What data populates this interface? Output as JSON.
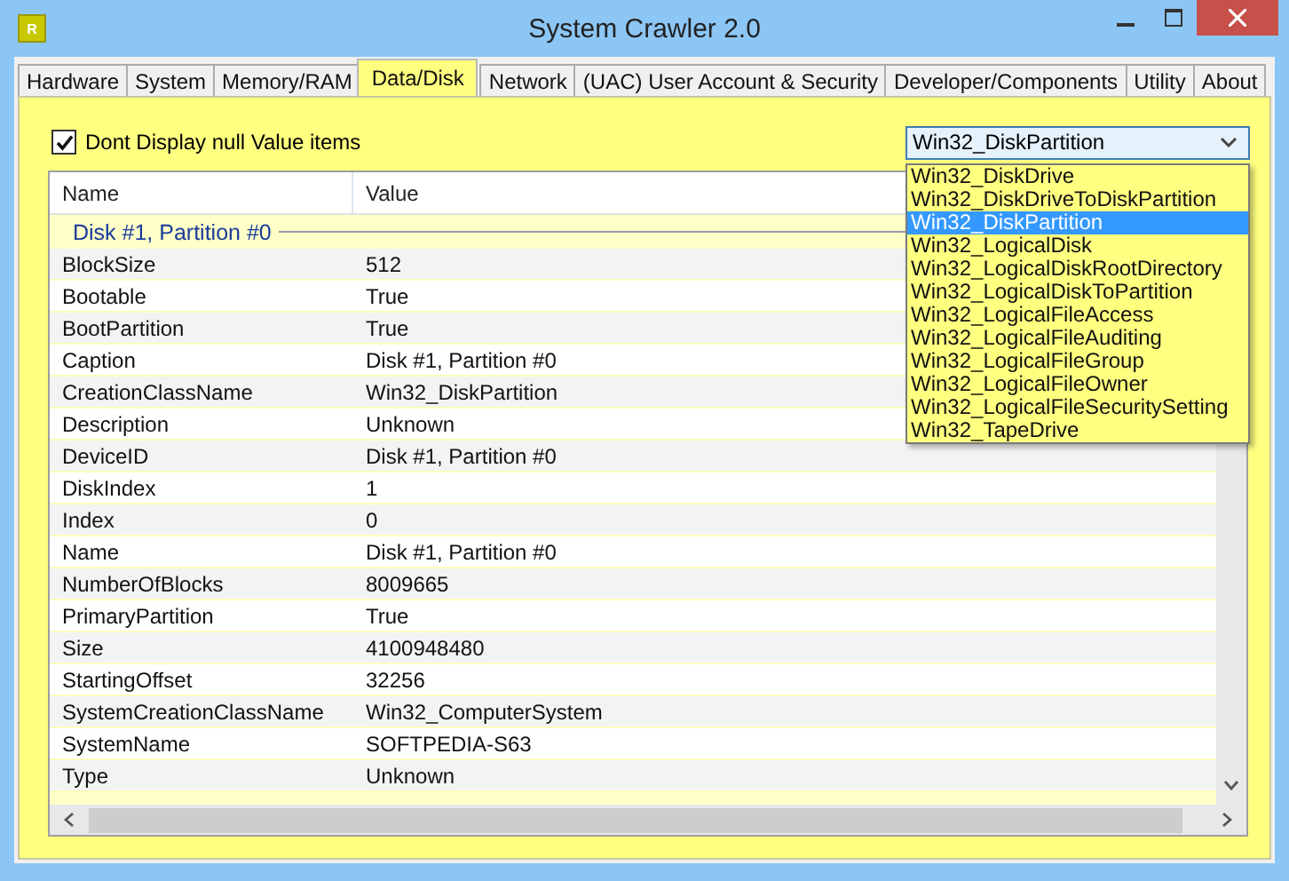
{
  "window": {
    "title": "System Crawler 2.0",
    "icon_letter": "R"
  },
  "tabs": [
    {
      "label": "Hardware",
      "selected": false
    },
    {
      "label": "System",
      "selected": false
    },
    {
      "label": "Memory/RAM",
      "selected": false
    },
    {
      "label": "Data/Disk",
      "selected": true
    },
    {
      "label": "Network",
      "selected": false
    },
    {
      "label": "(UAC) User Account & Security",
      "selected": false
    },
    {
      "label": "Developer/Components",
      "selected": false
    },
    {
      "label": "Utility",
      "selected": false
    },
    {
      "label": "About",
      "selected": false
    }
  ],
  "null_filter": {
    "label": "Dont Display null Value items",
    "checked": true
  },
  "class_dropdown": {
    "value": "Win32_DiskPartition",
    "expanded": true,
    "options": [
      {
        "label": "Win32_DiskDrive",
        "selected": false
      },
      {
        "label": "Win32_DiskDriveToDiskPartition",
        "selected": false
      },
      {
        "label": "Win32_DiskPartition",
        "selected": true
      },
      {
        "label": "Win32_LogicalDisk",
        "selected": false
      },
      {
        "label": "Win32_LogicalDiskRootDirectory",
        "selected": false
      },
      {
        "label": "Win32_LogicalDiskToPartition",
        "selected": false
      },
      {
        "label": "Win32_LogicalFileAccess",
        "selected": false
      },
      {
        "label": "Win32_LogicalFileAuditing",
        "selected": false
      },
      {
        "label": "Win32_LogicalFileGroup",
        "selected": false
      },
      {
        "label": "Win32_LogicalFileOwner",
        "selected": false
      },
      {
        "label": "Win32_LogicalFileSecuritySetting",
        "selected": false
      },
      {
        "label": "Win32_TapeDrive",
        "selected": false
      }
    ]
  },
  "table": {
    "columns": [
      "Name",
      "Value"
    ],
    "group": "Disk #1, Partition #0",
    "rows": [
      [
        "BlockSize",
        "512"
      ],
      [
        "Bootable",
        "True"
      ],
      [
        "BootPartition",
        "True"
      ],
      [
        "Caption",
        "Disk #1, Partition #0"
      ],
      [
        "CreationClassName",
        "Win32_DiskPartition"
      ],
      [
        "Description",
        "Unknown"
      ],
      [
        "DeviceID",
        "Disk #1, Partition #0"
      ],
      [
        "DiskIndex",
        "1"
      ],
      [
        "Index",
        "0"
      ],
      [
        "Name",
        "Disk #1, Partition #0"
      ],
      [
        "NumberOfBlocks",
        "8009665"
      ],
      [
        "PrimaryPartition",
        "True"
      ],
      [
        "Size",
        "4100948480"
      ],
      [
        "StartingOffset",
        "32256"
      ],
      [
        "SystemCreationClassName",
        "Win32_ComputerSystem"
      ],
      [
        "SystemName",
        "SOFTPEDIA-S63"
      ],
      [
        "Type",
        "Unknown"
      ]
    ]
  }
}
